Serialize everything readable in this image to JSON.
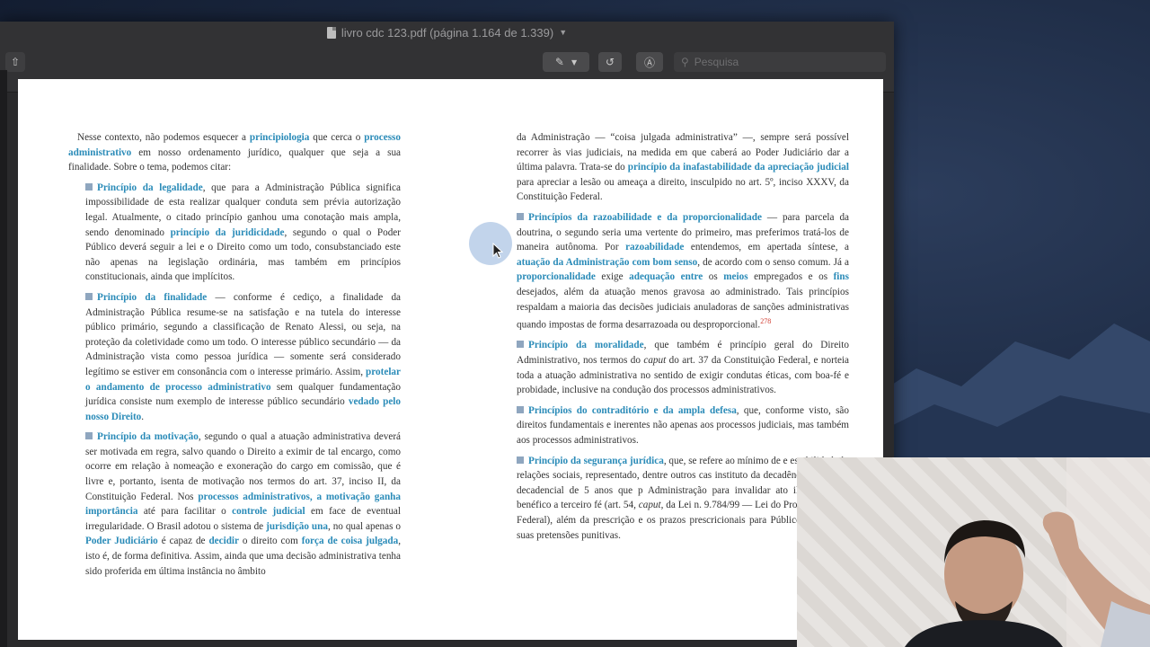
{
  "window": {
    "title": "livro cdc 123.pdf (página 1.164 de 1.339)",
    "search_placeholder": "Pesquisa"
  },
  "icons": [
    "share-icon",
    "pen-markup-icon",
    "chevron-down-icon",
    "rotate-icon",
    "markup-circle-icon",
    "search-icon"
  ],
  "colors": {
    "keyword": "#2a8bb8",
    "bullet": "#8fa6bf",
    "footnote": "#d03a2e"
  },
  "left_column": {
    "intro": {
      "t1": "Nesse contexto, não podemos esquecer a ",
      "k1": "principiologia",
      "t2": " que cerca o ",
      "k2": "processo administrativo",
      "t3": " em nosso ordenamento jurídico, qualquer que seja a sua finalidade. Sobre o tema, podemos citar:"
    },
    "legalidade": {
      "k1": "Princípio da legalidade",
      "t1": ", que para a Administração Pública significa impossibilidade de esta realizar qualquer conduta sem prévia autorização legal. Atualmente, o citado princípio ganhou uma conotação mais ampla, sendo denominado ",
      "k2": "princípio da juridicidade",
      "t2": ", segundo o qual o Poder Público deverá seguir a lei e o Direito como um todo, consubstanciado este não apenas na legislação ordinária, mas também em princípios constitucionais, ainda que implícitos."
    },
    "finalidade": {
      "k1": "Princípio da finalidade",
      "t1": " — conforme é cediço, a finalidade da Administração Pública resume-se na satisfação e na tutela do interesse público primário, segundo a classificação de Renato Alessi, ou seja, na proteção da coletividade como um todo. O interesse público secundário — da Administração vista como pessoa jurídica — somente será considerado legítimo se estiver em consonância com o interesse primário. Assim, ",
      "k2": "protelar o andamento de processo administrativo",
      "t2": " sem qualquer fundamentação jurídica consiste num exemplo de interesse público secundário ",
      "k3": "vedado pelo nosso Direito",
      "t3": "."
    },
    "motivacao": {
      "k1": "Princípio da motivação",
      "t1": ", segundo o qual a atuação administrativa deverá ser motivada em regra, salvo quando o Direito a eximir de tal encargo, como ocorre em relação à nomeação e exoneração do cargo em comissão, que é livre e, portanto, isenta de motivação nos termos do art. 37, inciso II, da Constituição Federal. Nos ",
      "k2": "processos administrativos, a motivação ganha importância",
      "t2": " até para facilitar o ",
      "k3": "controle judicial",
      "t3": " em face de eventual irregularidade. O Brasil adotou o sistema de ",
      "k4": "jurisdição una",
      "t4": ", no qual apenas o ",
      "k5": "Poder Judiciário",
      "t5": " é capaz de ",
      "k6": "decidir",
      "t6": " o direito com ",
      "k7": "força de coisa julgada",
      "t7": ", isto é, de forma definitiva. Assim, ainda que uma decisão administrativa tenha sido proferida em última instância no âmbito"
    }
  },
  "right_column": {
    "cont": {
      "t1": "da Administração — “coisa julgada administrativa” —, sempre será possível recorrer às vias judiciais, na medida em que caberá ao Poder Judiciário dar a última palavra. Trata-se do ",
      "k1": "princípio da inafastabilidade da apreciação judicial",
      "t2": " para apreciar a lesão ou ameaça a direito, insculpido no art. 5º, inciso XXXV, da Constituição Federal."
    },
    "razoabilidade": {
      "k1": "Princípios da razoabilidade e da proporcionalidade",
      "t1": " — para parcela da doutrina, o segundo seria uma vertente do primeiro, mas preferimos tratá-los de maneira autônoma. Por ",
      "k2": "razoabilidade",
      "t2": " entendemos, em apertada síntese, a ",
      "k3": "atuação da Administração com bom senso",
      "t3": ", de acordo com o senso comum. Já a ",
      "k4": "proporcionalidade",
      "t4": " exige ",
      "k5": "adequação entre",
      "t5": " os ",
      "k6": "meios",
      "t6": " empregados e os ",
      "k7": "fins",
      "t7": " desejados, além da atuação menos gravosa ao administrado. Tais princípios respaldam a maioria das decisões judiciais anuladoras de sanções administrativas quando impostas de forma desarrazoada ou desproporcional.",
      "footnote": "278"
    },
    "moralidade": {
      "k1": "Princípio da moralidade",
      "t1": ", que também é princípio geral do Direito Administrativo, nos termos do ",
      "i1": "caput",
      "t2": " do art. 37 da Constituição Federal, e norteia toda a atuação administrativa no sentido de exigir condutas éticas, com boa-fé e probidade, inclusive na condução dos processos administrativos."
    },
    "contraditorio": {
      "k1": "Princípios do contraditório e da ampla defesa",
      "t1": ", que, conforme visto, são direitos fundamentais e inerentes não apenas aos processos judiciais, mas também aos processos administrativos."
    },
    "seguranca": {
      "k1": "Princípio da segurança jurídica",
      "t1": ", que, se refere ao mínimo de e estabilidade às relações sociais, representado, dentre outros cas instituto da decadência e o prazo decadencial de 5 anos que p Administração para invalidar ato ilegal, porém benéfico a terceiro fé (art. 54, ",
      "i1": "caput",
      "t2": ", da Lei n. 9.784/99 — Lei do Processo Admin Federal), além da prescrição e os prazos prescricionais para Público fazer valer suas pretensões punitivas."
    }
  }
}
